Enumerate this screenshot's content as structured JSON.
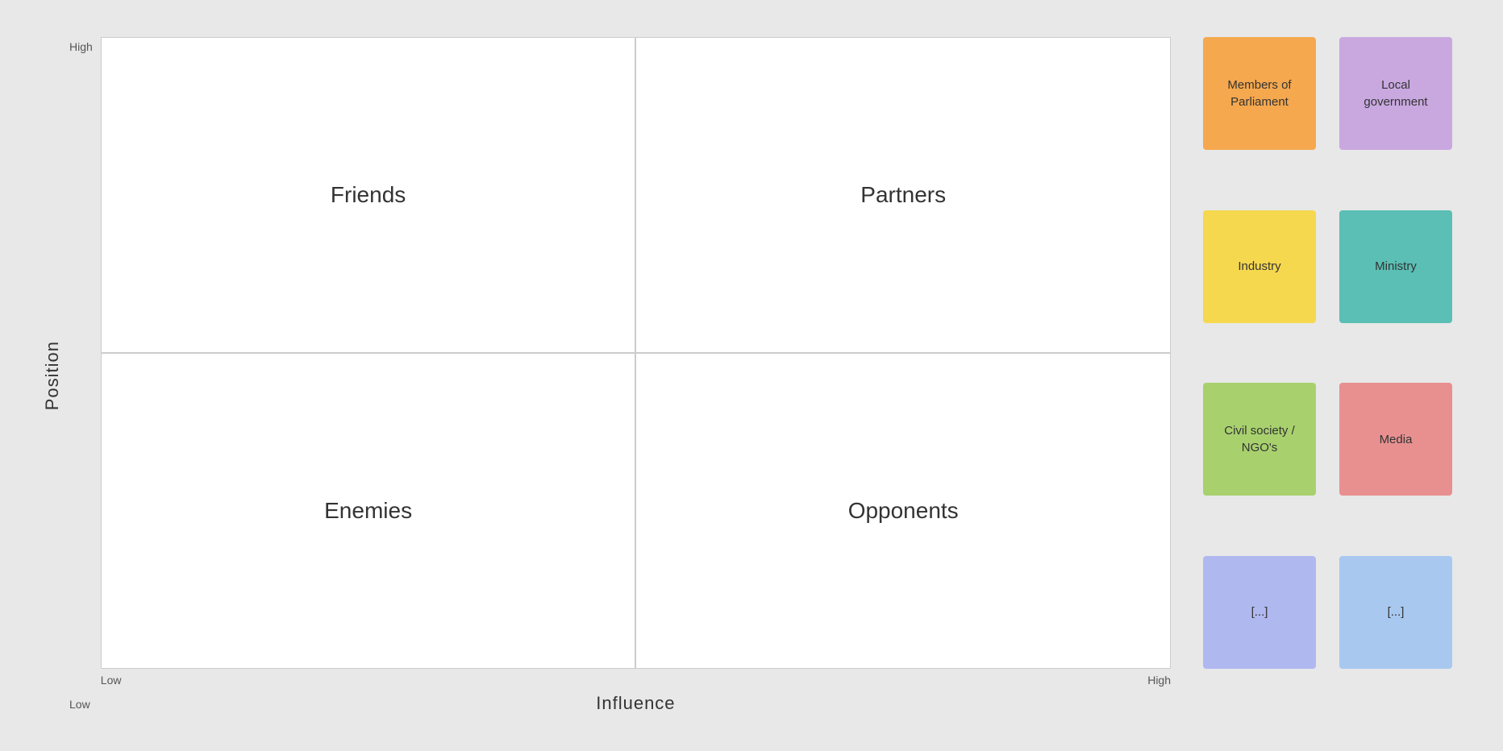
{
  "chart": {
    "y_axis_label": "Position",
    "x_axis_label": "Influence",
    "y_high": "High",
    "y_low": "Low",
    "x_low": "Low",
    "x_high": "High",
    "quadrants": [
      {
        "id": "friends",
        "label": "Friends",
        "position": "top-left"
      },
      {
        "id": "partners",
        "label": "Partners",
        "position": "top-right"
      },
      {
        "id": "enemies",
        "label": "Enemies",
        "position": "bottom-left"
      },
      {
        "id": "opponents",
        "label": "Opponents",
        "position": "bottom-right"
      }
    ]
  },
  "sidebar": {
    "notes": [
      {
        "id": "members-of-parliament",
        "label": "Members of Parliament",
        "color": "#F5A84E"
      },
      {
        "id": "local-government",
        "label": "Local government",
        "color": "#C9A8E0"
      },
      {
        "id": "industry",
        "label": "Industry",
        "color": "#F5D84E"
      },
      {
        "id": "ministry",
        "label": "Ministry",
        "color": "#5BBFB5"
      },
      {
        "id": "civil-society-ngo",
        "label": "Civil society / NGO's",
        "color": "#A8D16E"
      },
      {
        "id": "media",
        "label": "Media",
        "color": "#E89090"
      },
      {
        "id": "extra-1",
        "label": "[...]",
        "color": "#B0B8F0"
      },
      {
        "id": "extra-2",
        "label": "[...]",
        "color": "#A8C8F0"
      }
    ]
  }
}
